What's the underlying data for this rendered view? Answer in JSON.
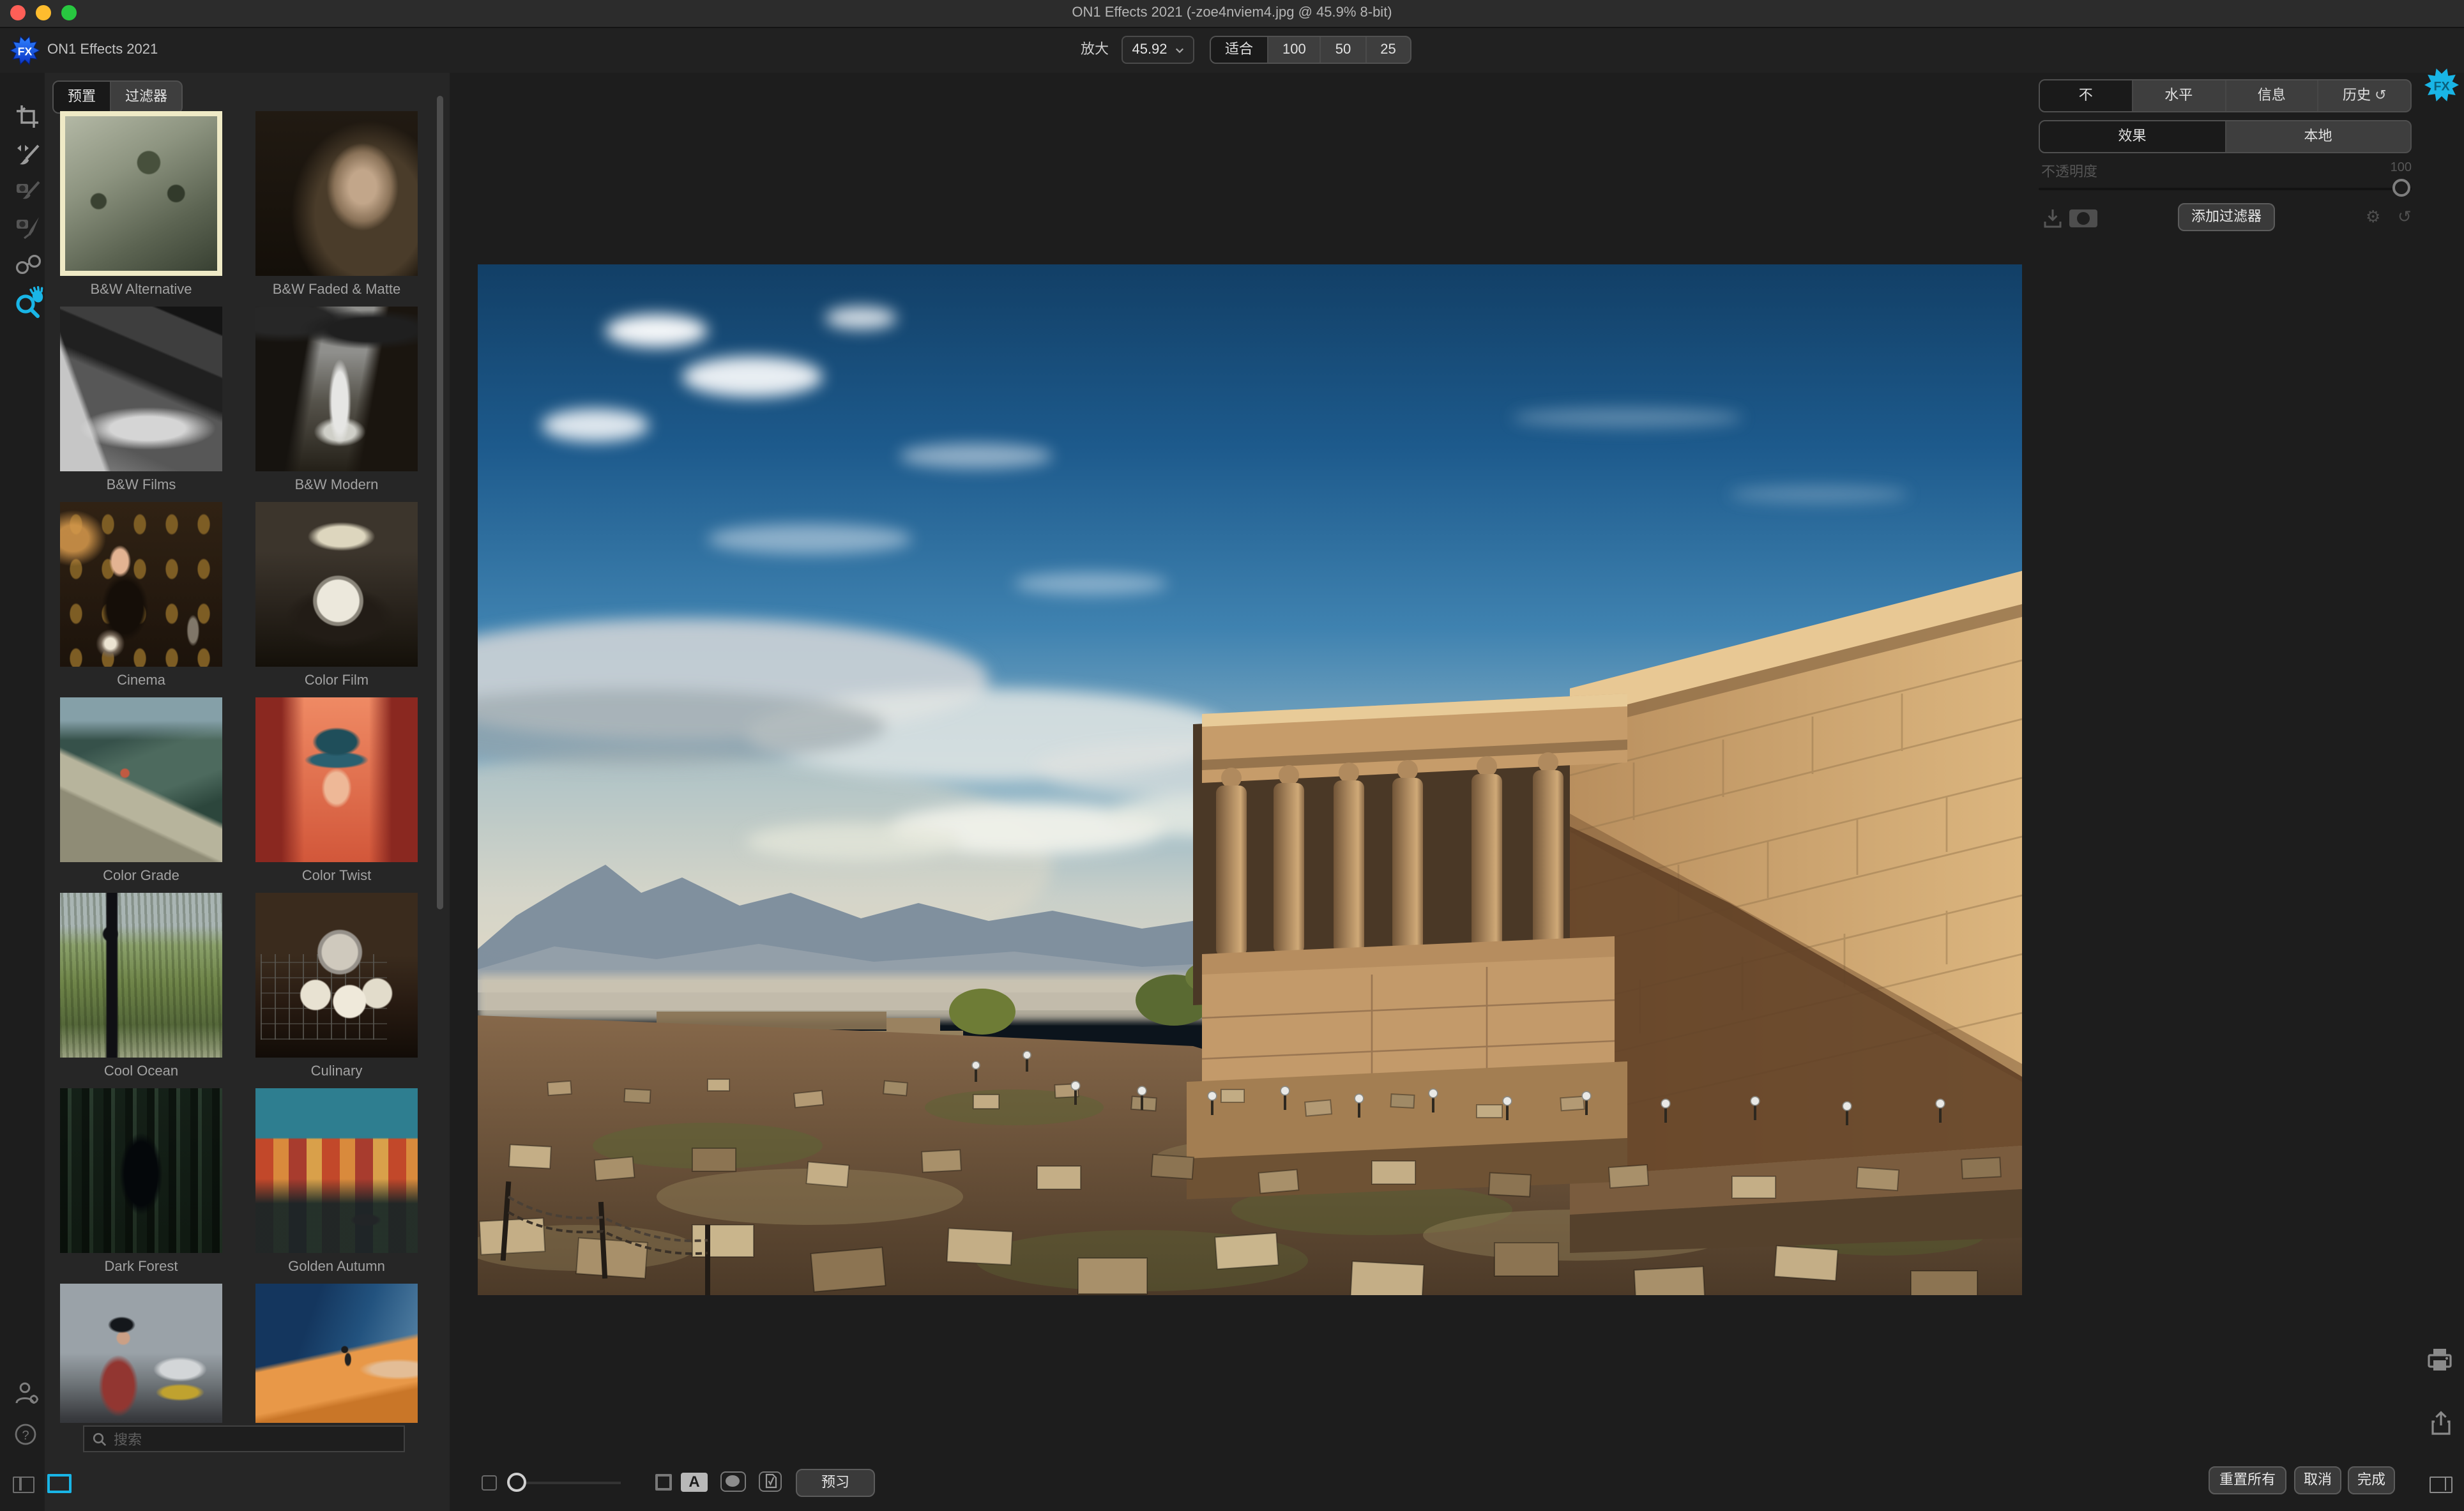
{
  "window": {
    "title": "ON1 Effects 2021 (-zoe4nviem4.jpg @ 45.9% 8-bit)",
    "traffic_lights": [
      "close",
      "minimize",
      "fullscreen"
    ]
  },
  "header": {
    "logo_text": "FX",
    "app_name": "ON1 Effects 2021",
    "zoom_label": "放大",
    "zoom_value": "45.92",
    "fit_options": [
      "适合",
      "100",
      "50",
      "25"
    ],
    "fit_selected": "适合"
  },
  "left_toolbar": {
    "tools": [
      "crop-tool",
      "adjust-brush-tool",
      "masking-brush-tool",
      "masking-bug-tool",
      "compare-view-tool",
      "zoom-pan-tool"
    ],
    "active_tool": "zoom-pan-tool",
    "bottom_icons": [
      "user-settings-icon",
      "help-icon"
    ]
  },
  "presets": {
    "tabs": [
      {
        "label": "预置",
        "active": true
      },
      {
        "label": "过滤器",
        "active": false
      }
    ],
    "search_placeholder": "搜索",
    "items": [
      {
        "label": "B&W Alternative",
        "selected": true
      },
      {
        "label": "B&W Faded & Matte",
        "selected": false
      },
      {
        "label": "B&W Films",
        "selected": false
      },
      {
        "label": "B&W Modern",
        "selected": false
      },
      {
        "label": "Cinema",
        "selected": false
      },
      {
        "label": "Color Film",
        "selected": false
      },
      {
        "label": "Color Grade",
        "selected": false
      },
      {
        "label": "Color Twist",
        "selected": false
      },
      {
        "label": "Cool Ocean",
        "selected": false
      },
      {
        "label": "Culinary",
        "selected": false
      },
      {
        "label": "Dark Forest",
        "selected": false
      },
      {
        "label": "Golden Autumn",
        "selected": false
      },
      {
        "label": "",
        "selected": false
      },
      {
        "label": "",
        "selected": false
      }
    ]
  },
  "right_panel": {
    "view_tabs": [
      {
        "label": "不",
        "active": true
      },
      {
        "label": "水平",
        "active": false
      },
      {
        "label": "信息",
        "active": false
      },
      {
        "label": "历史",
        "active": false,
        "icon": "history-undo-icon"
      }
    ],
    "history_glyph": "↺",
    "mode_tabs": [
      {
        "label": "效果",
        "active": true
      },
      {
        "label": "本地",
        "active": false
      }
    ],
    "opacity_label": "不透明度",
    "opacity_value": "100",
    "add_filter_label": "添加过滤器",
    "gear_glyph": "⚙",
    "undo_glyph": "↺"
  },
  "bottom_bar": {
    "preview_label": "预习",
    "original_toggle_label": "A",
    "reset_all_label": "重置所有",
    "cancel_label": "取消",
    "done_label": "完成"
  },
  "colors": {
    "accent_cyan": "#19b5e6",
    "selected_preset_border": "#efeac6",
    "logo_blue": "#1e63e8"
  }
}
